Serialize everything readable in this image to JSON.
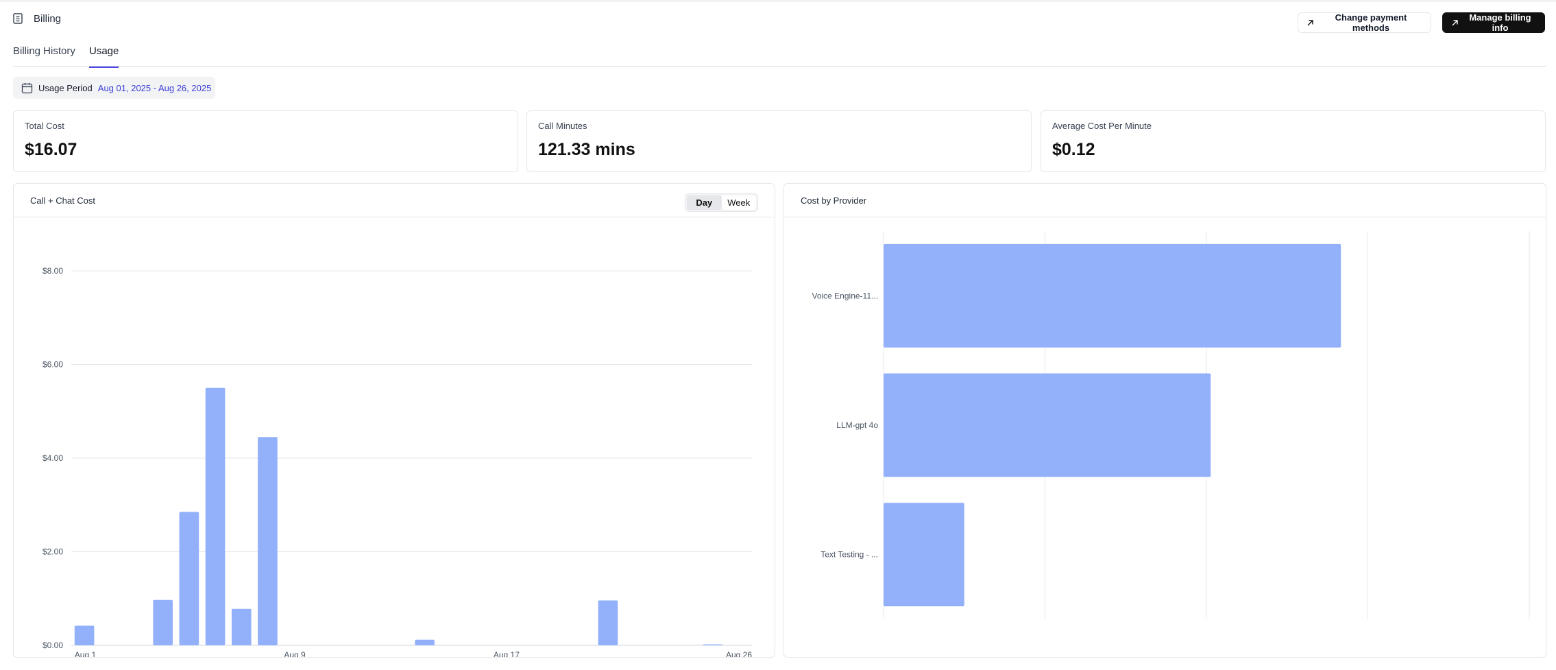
{
  "page": {
    "title": "Billing",
    "title_icon": "document-icon"
  },
  "header_actions": {
    "change_payment_label": "Change payment methods",
    "manage_billing_label": "Manage billing info",
    "icon": "arrow-up-right-icon"
  },
  "tabs": [
    {
      "label": "Billing History",
      "active": false
    },
    {
      "label": "Usage",
      "active": true
    }
  ],
  "usage_period": {
    "icon": "calendar-icon",
    "label": "Usage Period",
    "value": "Aug 01, 2025 - Aug 26, 2025"
  },
  "stats": [
    {
      "label": "Total Cost",
      "value": "$16.07"
    },
    {
      "label": "Call Minutes",
      "value": "121.33 mins"
    },
    {
      "label": "Average Cost Per Minute",
      "value": "$0.12"
    }
  ],
  "colors": {
    "bar": "#93b1fa",
    "accent": "#4f46e5",
    "period_value": "#3b3ed8"
  },
  "chart_data": [
    {
      "type": "bar",
      "title": "Call + Chat Cost",
      "toggle": {
        "options": [
          "Day",
          "Week"
        ],
        "selected": "Day"
      },
      "x": [
        "Aug 1",
        "Aug 2",
        "Aug 3",
        "Aug 4",
        "Aug 5",
        "Aug 6",
        "Aug 7",
        "Aug 8",
        "Aug 9",
        "Aug 10",
        "Aug 11",
        "Aug 12",
        "Aug 13",
        "Aug 14",
        "Aug 15",
        "Aug 16",
        "Aug 17",
        "Aug 18",
        "Aug 19",
        "Aug 20",
        "Aug 21",
        "Aug 22",
        "Aug 23",
        "Aug 24",
        "Aug 25",
        "Aug 26"
      ],
      "values": [
        0.42,
        0,
        0,
        0.97,
        2.85,
        5.5,
        0.78,
        4.45,
        0,
        0,
        0,
        0,
        0,
        0.12,
        0,
        0,
        0,
        0,
        0,
        0,
        0.96,
        0,
        0,
        0,
        0.02,
        0
      ],
      "x_tick_labels": [
        "Aug 1",
        "Aug 9",
        "Aug 17",
        "Aug 26"
      ],
      "y_ticks": [
        "$0.00",
        "$2.00",
        "$4.00",
        "$6.00",
        "$8.00"
      ],
      "ylim": [
        0,
        8
      ],
      "grid": true
    },
    {
      "type": "bar",
      "orientation": "horizontal",
      "title": "Cost by Provider",
      "categories": [
        "Voice Engine-11...",
        "LLM-gpt 4o",
        "Text Testing - ..."
      ],
      "values": [
        8.5,
        6.08,
        1.5
      ],
      "xlim": [
        0,
        12
      ],
      "grid": true
    }
  ]
}
